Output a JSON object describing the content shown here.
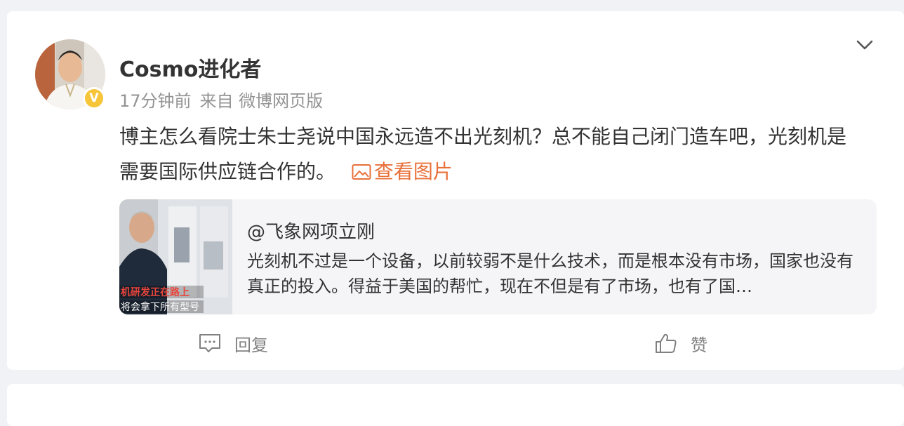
{
  "post": {
    "author": "Cosmo进化者",
    "time": "17分钟前",
    "source": "来自 微博网页版",
    "verified_badge": "V",
    "text": "博主怎么看院士朱士尧说中国永远造不出光刻机？总不能自己闭门造车吧，光刻机是需要国际供应链合作的。",
    "view_images": "查看图片",
    "accent_color": "#e8703a"
  },
  "quote": {
    "author": "@飞象网项立刚",
    "text": "光刻机不过是一个设备，以前较弱不是什么技术，而是根本没有市场，国家也没有真正的投入。得益于美国的帮忙，现在不但是有了市场，也有了国…",
    "thumb_caption_1": "机研发正在路上",
    "thumb_caption_2": "将会拿下所有型号"
  },
  "actions": {
    "reply": "回复",
    "like": "赞"
  }
}
